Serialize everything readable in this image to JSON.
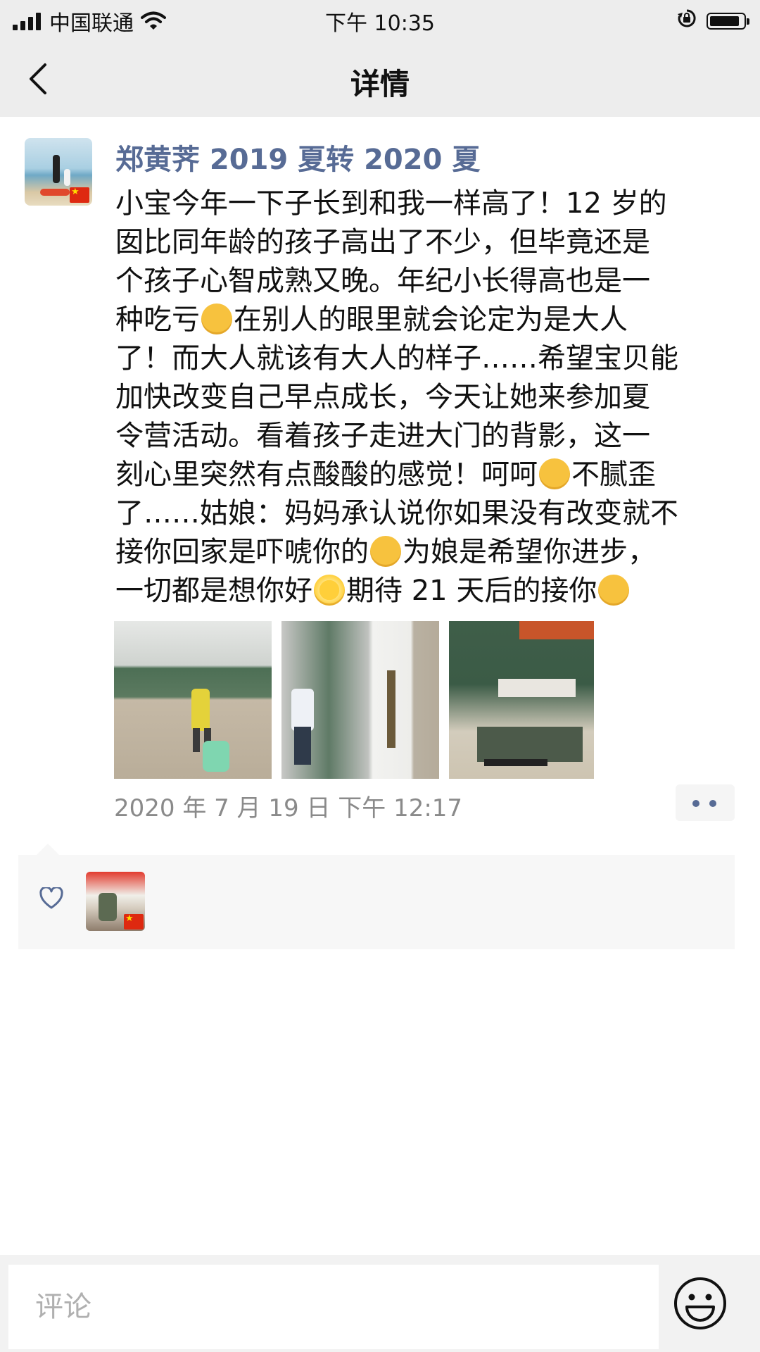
{
  "status_bar": {
    "carrier": "中国联通",
    "time": "下午 10:35"
  },
  "nav": {
    "title": "详情"
  },
  "post": {
    "username": "郑黄荠 2019 夏转 2020 夏",
    "lines": [
      {
        "parts": [
          {
            "t": "小宝今年一下子长到和我一样高了！12 岁的"
          }
        ]
      },
      {
        "parts": [
          {
            "t": "囡比同年龄的孩子高出了不少，但毕竟还是"
          }
        ]
      },
      {
        "parts": [
          {
            "t": "个孩子心智成熟又晚。年纪小长得高也是一"
          }
        ]
      },
      {
        "parts": [
          {
            "t": "种吃亏"
          },
          {
            "emoji": "grin-emoji"
          },
          {
            "t": "在别人的眼里就会论定为是大人"
          }
        ]
      },
      {
        "parts": [
          {
            "t": "了！而大人就该有大人的样子……希望宝贝能"
          }
        ]
      },
      {
        "parts": [
          {
            "t": "加快改变自己早点成长，今天让她来参加夏"
          }
        ]
      },
      {
        "parts": [
          {
            "t": "令营活动。看着孩子走进大门的背影，这一"
          }
        ]
      },
      {
        "parts": [
          {
            "t": "刻心里突然有点酸酸的感觉！呵呵"
          },
          {
            "emoji": "smile-emoji"
          },
          {
            "t": "不腻歪"
          }
        ]
      },
      {
        "parts": [
          {
            "t": "了……姑娘：妈妈承认说你如果没有改变就不"
          }
        ]
      },
      {
        "parts": [
          {
            "t": "接你回家是吓唬你的"
          },
          {
            "emoji": "heart-eyes-emoji"
          },
          {
            "t": "为娘是希望你进步，"
          }
        ]
      },
      {
        "parts": [
          {
            "t": "一切都是想你好"
          },
          {
            "emoji": "sun-emoji"
          },
          {
            "t": "期待 21 天后的接你"
          },
          {
            "emoji": "blush-emoji"
          }
        ]
      }
    ],
    "timestamp": "2020 年 7 月 19 日  下午 12:17"
  },
  "comment": {
    "placeholder": "评论"
  }
}
